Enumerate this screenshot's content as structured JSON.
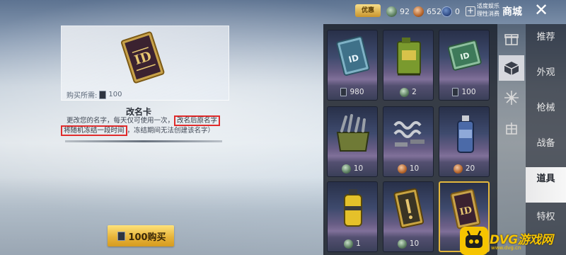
{
  "topbar": {
    "vip_label": "优惠",
    "currencies": [
      {
        "icon": "green-coin-icon",
        "value": "92"
      },
      {
        "icon": "bronze-coin-icon",
        "value": "652"
      },
      {
        "icon": "blue-coupon-icon",
        "value": "0"
      }
    ],
    "entertainment_line1": "适度娱乐",
    "entertainment_line2": "理性消费",
    "shop_title": "商城",
    "close_label": "✕"
  },
  "detail": {
    "price_prefix": "购买所需:",
    "price_value": "100",
    "item_name": "改名卡",
    "desc_line1_a": "更改您的名字，每天仅可使用一次，",
    "desc_line1_highlight": "改名后原名字",
    "desc_line2_highlight": "将随机冻结一段时间",
    "desc_line2_b": "，冻结期间无法创建该名字）",
    "buy_label": "100购买"
  },
  "grid": [
    {
      "name": "id-card-blue",
      "price": "980",
      "currency": "ticket"
    },
    {
      "name": "green-jerrycan",
      "price": "2",
      "currency": "green"
    },
    {
      "name": "id-card-green",
      "price": "100",
      "currency": "ticket"
    },
    {
      "name": "tool-crate",
      "price": "10",
      "currency": "green"
    },
    {
      "name": "spring-parts",
      "price": "10",
      "currency": "bronze"
    },
    {
      "name": "spray-can",
      "price": "20",
      "currency": "bronze"
    },
    {
      "name": "yellow-canister",
      "price": "1",
      "currency": "green"
    },
    {
      "name": "warning-card",
      "price": "10",
      "currency": "green"
    },
    {
      "name": "rename-card",
      "price": "",
      "currency": "ticket"
    }
  ],
  "side_icons": [
    "gift-icon",
    "box-icon",
    "flower-icon",
    "gift-box-icon"
  ],
  "categories": [
    {
      "label": "推荐"
    },
    {
      "label": "外观"
    },
    {
      "label": "枪械"
    },
    {
      "label": "战备"
    },
    {
      "label": "道具"
    },
    {
      "label": "特权"
    }
  ],
  "watermark": {
    "title": "DVG游戏网",
    "sub": "www.dvg.cn"
  },
  "colors": {
    "accent_gold": "#e4b83d",
    "highlight_red": "#e02b2b"
  }
}
